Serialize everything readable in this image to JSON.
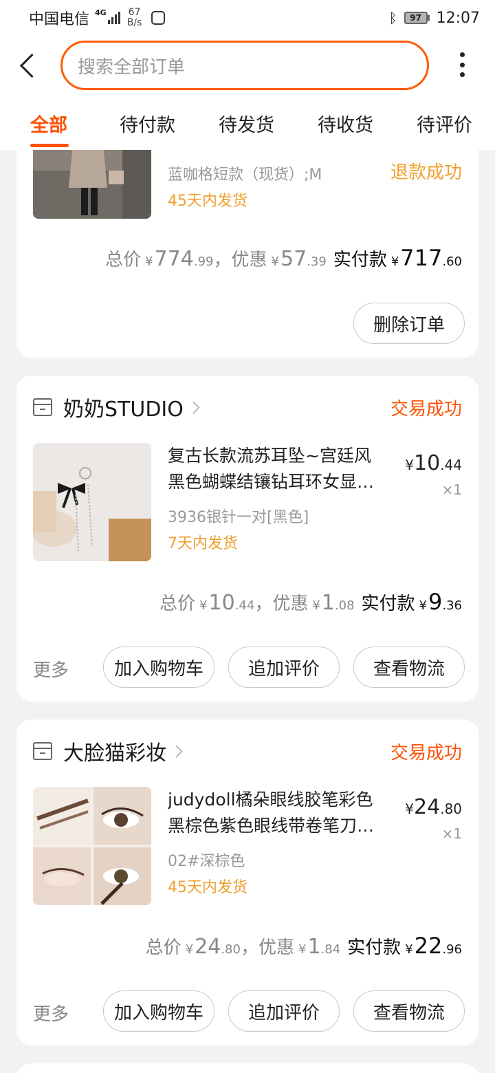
{
  "status_bar": {
    "carrier": "中国电信",
    "network": "4G",
    "speed_value": "67",
    "speed_unit": "B/s",
    "battery": "97",
    "time": "12:07"
  },
  "header": {
    "search_placeholder": "搜索全部订单"
  },
  "tabs": [
    {
      "label": "全部",
      "active": true
    },
    {
      "label": "待付款",
      "active": false
    },
    {
      "label": "待发货",
      "active": false
    },
    {
      "label": "待收货",
      "active": false
    },
    {
      "label": "待评价",
      "active": false
    }
  ],
  "orders": [
    {
      "status": "退款成功",
      "item": {
        "sku": "蓝咖格短款（现货）;M",
        "ship": "45天内发货"
      },
      "totals": {
        "total_label": "总价",
        "total_int": "774",
        "total_dec": ".99",
        "discount_label": "，优惠",
        "discount_int": "57",
        "discount_dec": ".39",
        "paid_label": "实付款",
        "paid_int": "717",
        "paid_dec": ".60",
        "currency": "¥"
      },
      "buttons": [
        "删除订单"
      ]
    },
    {
      "store": "奶奶STUDIO",
      "status": "交易成功",
      "item": {
        "title_line1": "复古长款流苏耳坠~宫廷风",
        "title_line2": "黑色蝴蝶结镶钻耳环女显…",
        "sku": "3936银针一对[黑色]",
        "ship": "7天内发货",
        "price_int": "10",
        "price_dec": ".44",
        "qty": "×1"
      },
      "totals": {
        "total_label": "总价",
        "total_int": "10",
        "total_dec": ".44",
        "discount_label": "，优惠",
        "discount_int": "1",
        "discount_dec": ".08",
        "paid_label": "实付款",
        "paid_int": "9",
        "paid_dec": ".36",
        "currency": "¥"
      },
      "more": "更多",
      "buttons": [
        "加入购物车",
        "追加评价",
        "查看物流"
      ]
    },
    {
      "store": "大脸猫彩妆",
      "status": "交易成功",
      "item": {
        "title_line1": "judydoll橘朵眼线胶笔彩色",
        "title_line2": "黑棕色紫色眼线带卷笔刀…",
        "sku": "02#深棕色",
        "ship": "45天内发货",
        "price_int": "24",
        "price_dec": ".80",
        "qty": "×1"
      },
      "totals": {
        "total_label": "总价",
        "total_int": "24",
        "total_dec": ".80",
        "discount_label": "，优惠",
        "discount_int": "1",
        "discount_dec": ".84",
        "paid_label": "实付款",
        "paid_int": "22",
        "paid_dec": ".96",
        "currency": "¥"
      },
      "more": "更多",
      "buttons": [
        "加入购物车",
        "追加评价",
        "查看物流"
      ]
    }
  ],
  "colors": {
    "accent": "#ff5000",
    "ship_text": "#f0a030",
    "refund_text": "#f0a030"
  }
}
